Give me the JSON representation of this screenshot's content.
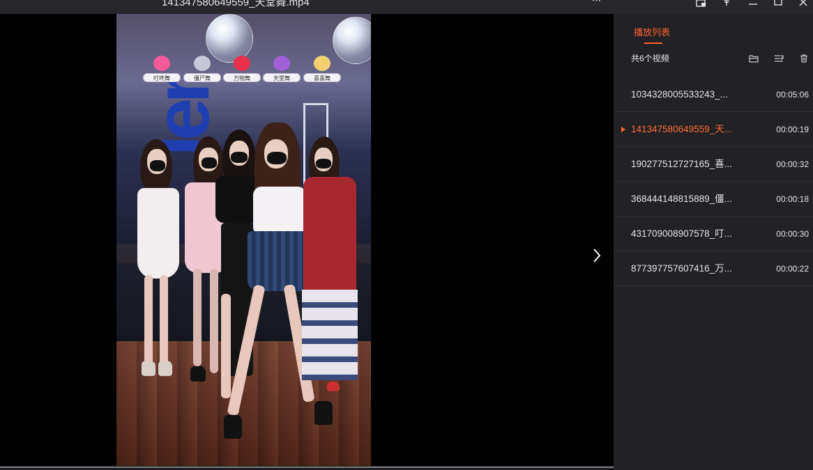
{
  "window": {
    "title": "141347580649559_天堂舞.mp4",
    "more_label": "···"
  },
  "video": {
    "stickers": [
      "叮咚舞",
      "僵尸舞",
      "万物舞",
      "天堂舞",
      "喜喜舞"
    ],
    "sticker_colors": [
      "#f25a9a",
      "#c8c8d8",
      "#e8304a",
      "#a060d8",
      "#f0d070"
    ]
  },
  "playlist": {
    "tab_label": "播放列表",
    "count_label": "共6个视频",
    "accent_color": "#ff5f32",
    "items": [
      {
        "name": "1034328005533243_...",
        "duration": "00:05:06",
        "active": false
      },
      {
        "name": "141347580649559_天...",
        "duration": "00:00:19",
        "active": true
      },
      {
        "name": "190277512727165_喜...",
        "duration": "00:00:32",
        "active": false
      },
      {
        "name": "368444148815889_僵...",
        "duration": "00:00:18",
        "active": false
      },
      {
        "name": "431709008907578_叮...",
        "duration": "00:00:30",
        "active": false
      },
      {
        "name": "877397757607416_万...",
        "duration": "00:00:22",
        "active": false
      }
    ]
  }
}
